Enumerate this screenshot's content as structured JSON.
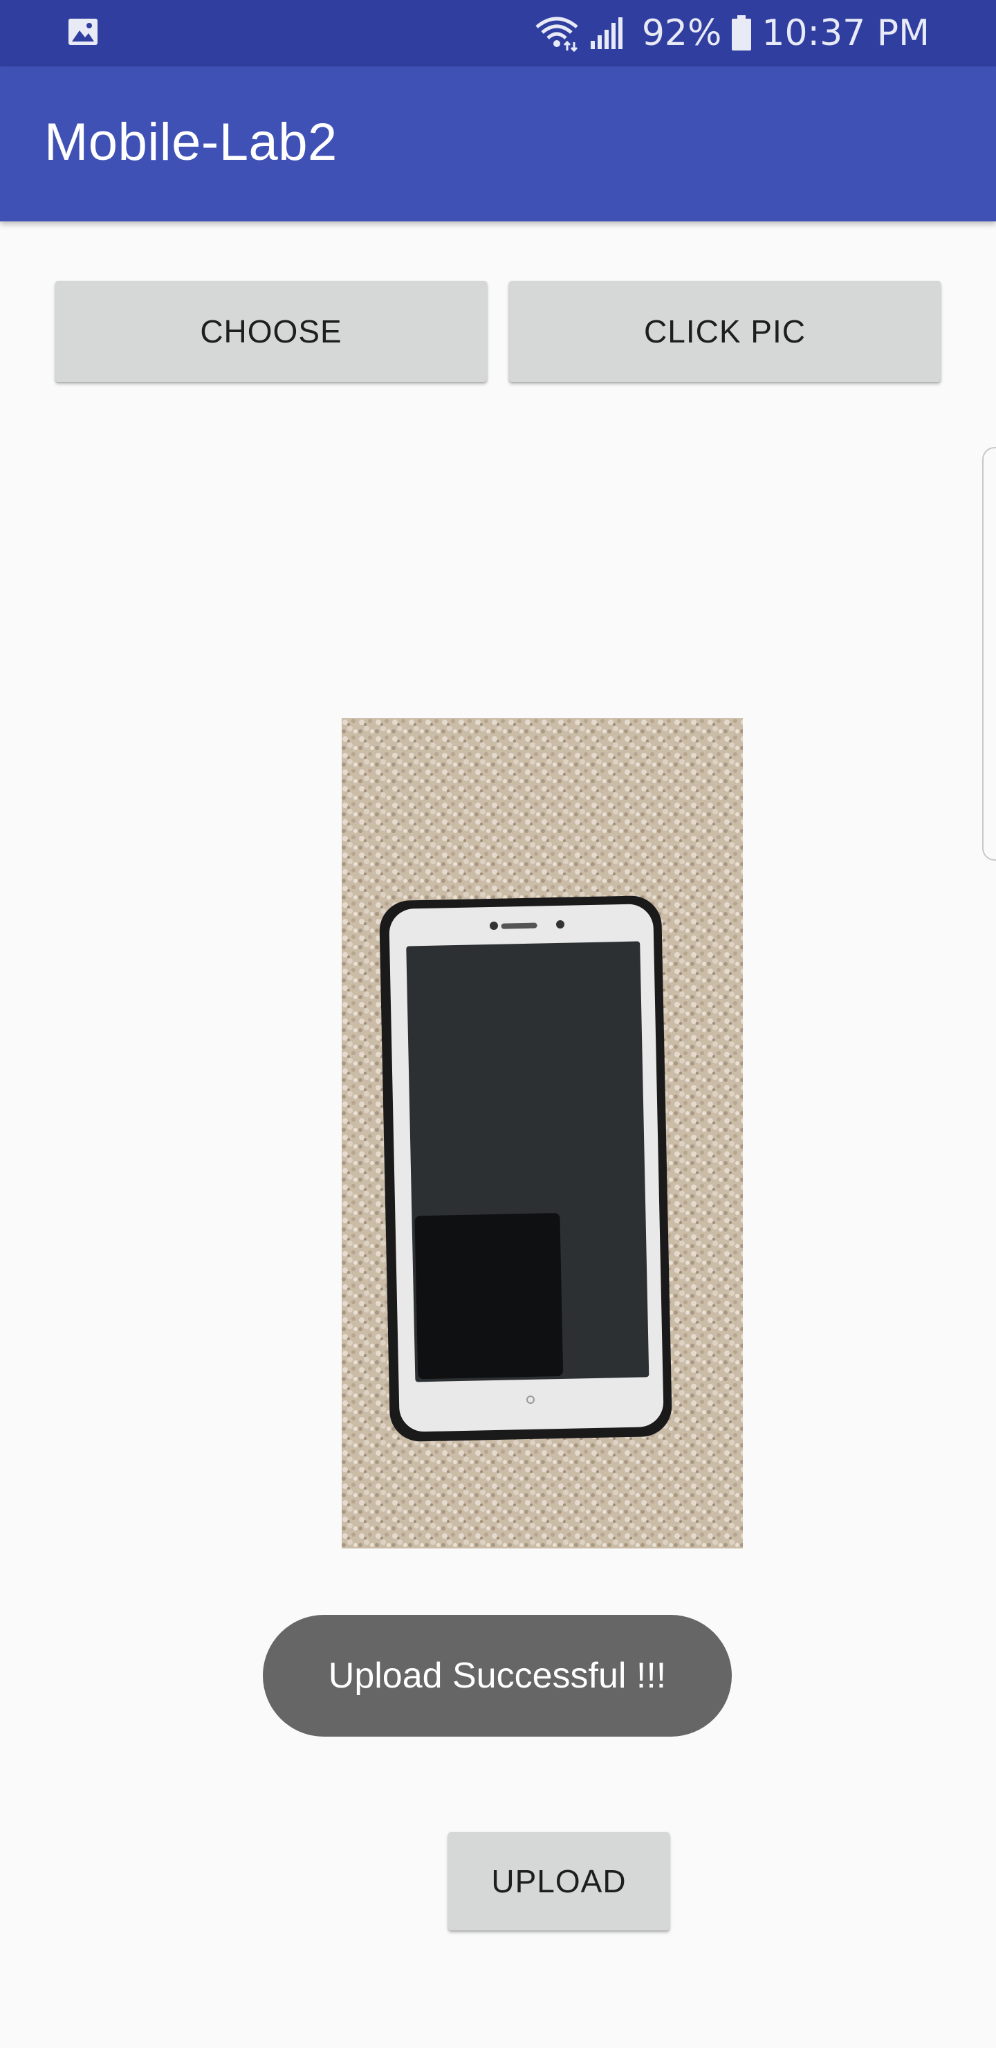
{
  "status_bar": {
    "notification_icon": "gallery-icon",
    "wifi_icon": "wifi-icon",
    "signal_icon": "signal-icon",
    "battery_icon": "battery-icon",
    "battery_percent": "92%",
    "time": "10:37 PM"
  },
  "app_bar": {
    "title": "Mobile-Lab2"
  },
  "buttons": {
    "choose_label": "CHOOSE",
    "click_pic_label": "CLICK PIC",
    "upload_label": "UPLOAD"
  },
  "toast": {
    "message": "Upload Successful !!!"
  },
  "colors": {
    "status_bar": "#303f9f",
    "app_bar": "#3f51b5",
    "button": "#d6d7d7",
    "toast": "#666666",
    "background": "#fafafa"
  }
}
